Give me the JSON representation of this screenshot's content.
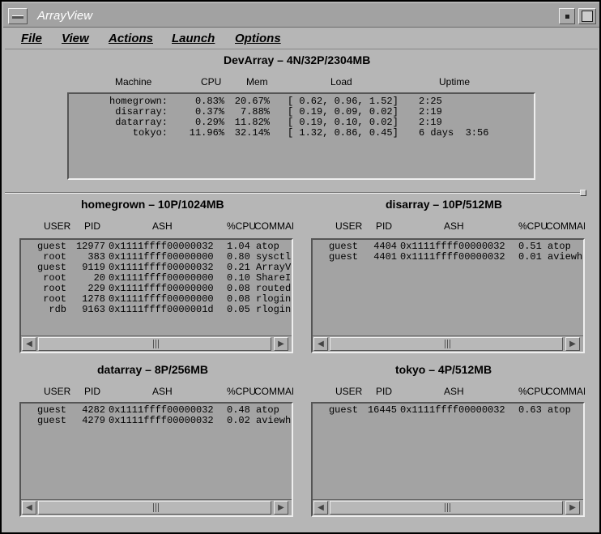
{
  "window": {
    "title": "ArrayView"
  },
  "menu": [
    "File",
    "View",
    "Actions",
    "Launch",
    "Options"
  ],
  "summary": {
    "title": "DevArray – 4N/32P/2304MB",
    "headers": {
      "machine": "Machine",
      "cpu": "CPU",
      "mem": "Mem",
      "load": "Load",
      "uptime": "Uptime"
    },
    "rows": [
      {
        "machine": "homegrown:",
        "cpu": "0.83%",
        "mem": "20.67%",
        "load": "[ 0.62, 0.96, 1.52]",
        "uptime": "2:25"
      },
      {
        "machine": "disarray:",
        "cpu": "0.37%",
        "mem": "7.88%",
        "load": "[ 0.19, 0.09, 0.02]",
        "uptime": "2:19"
      },
      {
        "machine": "datarray:",
        "cpu": "0.29%",
        "mem": "11.82%",
        "load": "[ 0.19, 0.10, 0.02]",
        "uptime": "2:19"
      },
      {
        "machine": "tokyo:",
        "cpu": "11.96%",
        "mem": "32.14%",
        "load": "[ 1.32, 0.86, 0.45]",
        "uptime": "6 days  3:56"
      }
    ]
  },
  "process_headers": {
    "user": "USER",
    "pid": "PID",
    "ash": "ASH",
    "cpu": "%CPU",
    "command": "COMMAND"
  },
  "nodes": [
    {
      "title": "homegrown – 10P/1024MB",
      "rows": [
        {
          "user": "guest",
          "pid": "12977",
          "ash": "0x1111ffff00000032",
          "cpu": "1.04",
          "command": "atop"
        },
        {
          "user": "root",
          "pid": "383",
          "ash": "0x1111ffff00000000",
          "cpu": "0.80",
          "command": "sysctl"
        },
        {
          "user": "guest",
          "pid": "9119",
          "ash": "0x1111ffff00000032",
          "cpu": "0.21",
          "command": "ArrayV"
        },
        {
          "user": "root",
          "pid": "20",
          "ash": "0x1111ffff00000000",
          "cpu": "0.10",
          "command": "ShareI"
        },
        {
          "user": "root",
          "pid": "229",
          "ash": "0x1111ffff00000000",
          "cpu": "0.08",
          "command": "routed"
        },
        {
          "user": "root",
          "pid": "1278",
          "ash": "0x1111ffff00000000",
          "cpu": "0.08",
          "command": "rlogin"
        },
        {
          "user": "rdb",
          "pid": "9163",
          "ash": "0x1111ffff0000001d",
          "cpu": "0.05",
          "command": "rlogin"
        }
      ]
    },
    {
      "title": "disarray – 10P/512MB",
      "rows": [
        {
          "user": "guest",
          "pid": "4404",
          "ash": "0x1111ffff00000032",
          "cpu": "0.51",
          "command": "atop"
        },
        {
          "user": "guest",
          "pid": "4401",
          "ash": "0x1111ffff00000032",
          "cpu": "0.01",
          "command": "aviewh"
        }
      ]
    },
    {
      "title": "datarray – 8P/256MB",
      "rows": [
        {
          "user": "guest",
          "pid": "4282",
          "ash": "0x1111ffff00000032",
          "cpu": "0.48",
          "command": "atop"
        },
        {
          "user": "guest",
          "pid": "4279",
          "ash": "0x1111ffff00000032",
          "cpu": "0.02",
          "command": "aviewh"
        }
      ]
    },
    {
      "title": "tokyo – 4P/512MB",
      "rows": [
        {
          "user": "guest",
          "pid": "16445",
          "ash": "0x1111ffff00000032",
          "cpu": "0.63",
          "command": "atop"
        }
      ]
    }
  ]
}
